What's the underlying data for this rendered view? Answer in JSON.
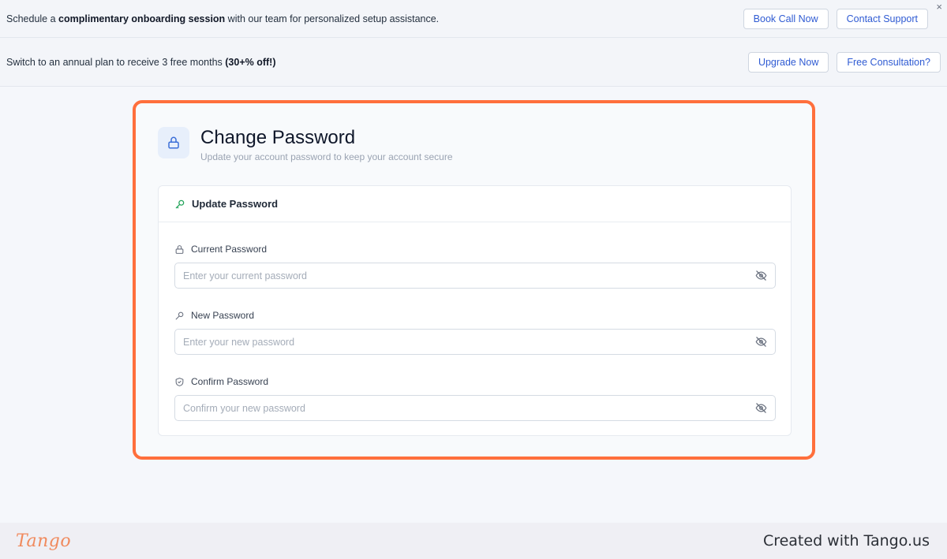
{
  "banner_onboarding": {
    "text_prefix": "Schedule a ",
    "text_bold": "complimentary onboarding session",
    "text_suffix": " with our team for personalized setup assistance.",
    "book_call_label": "Book Call Now",
    "contact_support_label": "Contact Support",
    "close_glyph": "×"
  },
  "banner_plan": {
    "text_prefix": "Switch to an annual plan to receive 3 free months ",
    "text_bold": "(30+% off!)",
    "upgrade_label": "Upgrade Now",
    "consultation_label": "Free Consultation?"
  },
  "page": {
    "title": "Change Password",
    "subtitle": "Update your account password to keep your account secure"
  },
  "panel": {
    "heading": "Update Password",
    "fields": [
      {
        "label": "Current Password",
        "placeholder": "Enter your current password",
        "icon": "lock-icon"
      },
      {
        "label": "New Password",
        "placeholder": "Enter your new password",
        "icon": "key-icon"
      },
      {
        "label": "Confirm Password",
        "placeholder": "Confirm your new password",
        "icon": "shield-icon"
      }
    ]
  },
  "footer": {
    "logo": "Tango",
    "created_text": "Created with Tango.us"
  },
  "colors": {
    "highlight": "#ff6f3c",
    "link_blue": "#2f5bd3",
    "key_green": "#22a35a",
    "lock_blue": "#3b6fd8"
  }
}
